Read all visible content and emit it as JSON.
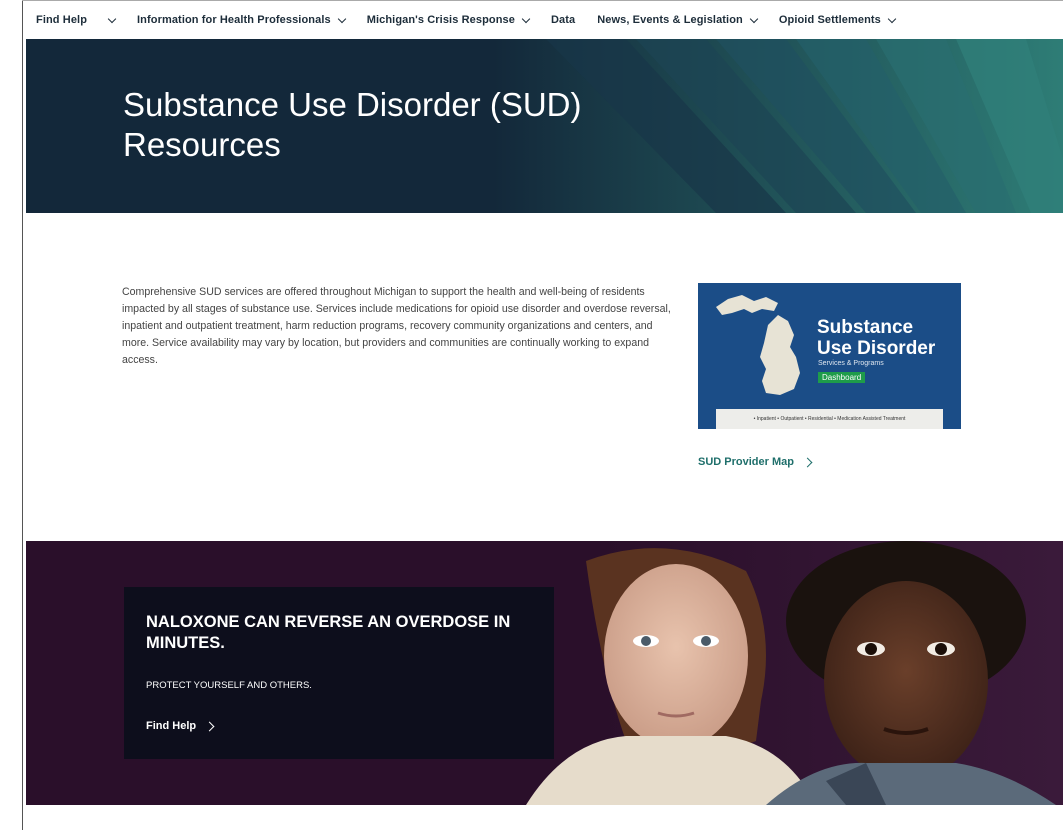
{
  "nav": {
    "items": [
      {
        "label": "Find Help",
        "has_dropdown": true
      },
      {
        "label": "Information for Health Professionals",
        "has_dropdown": true
      },
      {
        "label": "Michigan's Crisis Response",
        "has_dropdown": true
      },
      {
        "label": "Data",
        "has_dropdown": false
      },
      {
        "label": "News, Events & Legislation",
        "has_dropdown": true
      },
      {
        "label": "Opioid Settlements",
        "has_dropdown": true
      }
    ]
  },
  "hero": {
    "title": "Substance Use Disorder (SUD) Resources",
    "background_color": "#13283a",
    "accent_color": "#2e7d76"
  },
  "intro": {
    "paragraph": "Comprehensive SUD services are offered throughout Michigan to support the health and well-being of residents impacted by all stages of substance use. Services include medications for opioid use disorder and overdose reversal, inpatient and outpatient treatment, harm reduction programs, recovery community organizations and centers, and more. Service availability may vary by location, but providers and communities are continually working to expand access."
  },
  "dashboard_card": {
    "title_line1": "Substance",
    "title_line2": "Use Disorder",
    "subtitle": "Services & Programs",
    "badge": "Dashboard",
    "footer": "• Inpatient • Outpatient • Residential • Medication Assisted Treatment",
    "background_color": "#1b4d87",
    "badge_color": "#1e9c4a"
  },
  "provider_link": {
    "label": "SUD Provider Map",
    "color": "#1f6f6b"
  },
  "banner": {
    "headline": "NALOXONE CAN REVERSE AN OVERDOSE IN MINUTES.",
    "subtext": "PROTECT YOURSELF AND OTHERS.",
    "link_label": "Find Help",
    "background_color": "#2a0f2a",
    "callout_color": "#0d0e1c"
  }
}
